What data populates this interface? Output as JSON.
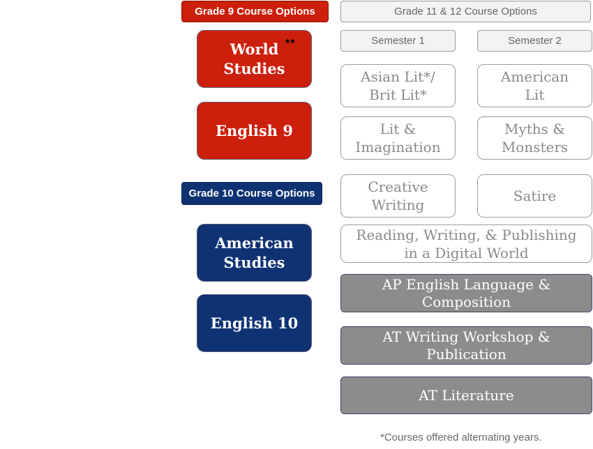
{
  "grade9": {
    "header": "Grade 9 Course Options",
    "world_studies": "World Studies",
    "world_studies_mark": "**",
    "english9": "English 9"
  },
  "grade10": {
    "header": "Grade 10 Course Options",
    "american_studies": "American Studies",
    "english10": "English 10"
  },
  "upper": {
    "header": "Grade 11 & 12 Course Options",
    "semester1": "Semester 1",
    "semester2": "Semester 2",
    "electives": {
      "asian_brit_lit": "Asian Lit*/ Brit Lit*",
      "american_lit": "American Lit",
      "lit_imagination": "Lit & Imagination",
      "myths_monsters": "Myths & Monsters",
      "creative_writing": "Creative Writing",
      "satire": "Satire",
      "digital_publishing": "Reading, Writing, & Publishing in a Digital World"
    },
    "advanced": {
      "ap_language": "AP English Language & Composition",
      "at_writing": "AT Writing Workshop & Publication",
      "at_literature": "AT Literature"
    }
  },
  "footnote": "*Courses offered alternating years.",
  "colors": {
    "grade9_red": "#cc1f0c",
    "grade10_blue": "#0f3273",
    "advanced_gray": "#8c8c8c",
    "elective_text": "#8a8a8a"
  }
}
